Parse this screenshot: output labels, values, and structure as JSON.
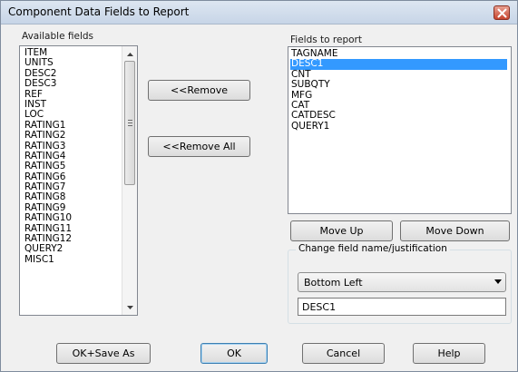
{
  "window": {
    "title": "Component Data Fields to Report"
  },
  "available": {
    "label": "Available fields",
    "items": [
      "ITEM",
      "UNITS",
      "DESC2",
      "DESC3",
      "REF",
      "INST",
      "LOC",
      "RATING1",
      "RATING2",
      "RATING3",
      "RATING4",
      "RATING5",
      "RATING6",
      "RATING7",
      "RATING8",
      "RATING9",
      "RATING10",
      "RATING11",
      "RATING12",
      "QUERY2",
      "MISC1"
    ]
  },
  "report": {
    "label": "Fields to report",
    "items": [
      "TAGNAME",
      "DESC1",
      "CNT",
      "SUBQTY",
      "MFG",
      "CAT",
      "CATDESC",
      "QUERY1"
    ],
    "selected_index": 1
  },
  "middle": {
    "remove_label": "<<Remove",
    "remove_all_label": "<<Remove All"
  },
  "order": {
    "move_up_label": "Move Up",
    "move_down_label": "Move Down"
  },
  "change": {
    "group_label": "Change field name/justification",
    "justification_value": "Bottom Left",
    "field_name_value": "DESC1"
  },
  "footer": {
    "ok_save_as_label": "OK+Save As",
    "ok_label": "OK",
    "cancel_label": "Cancel",
    "help_label": "Help"
  },
  "colors": {
    "selection": "#3399ff",
    "close_button": "#c7442e"
  }
}
